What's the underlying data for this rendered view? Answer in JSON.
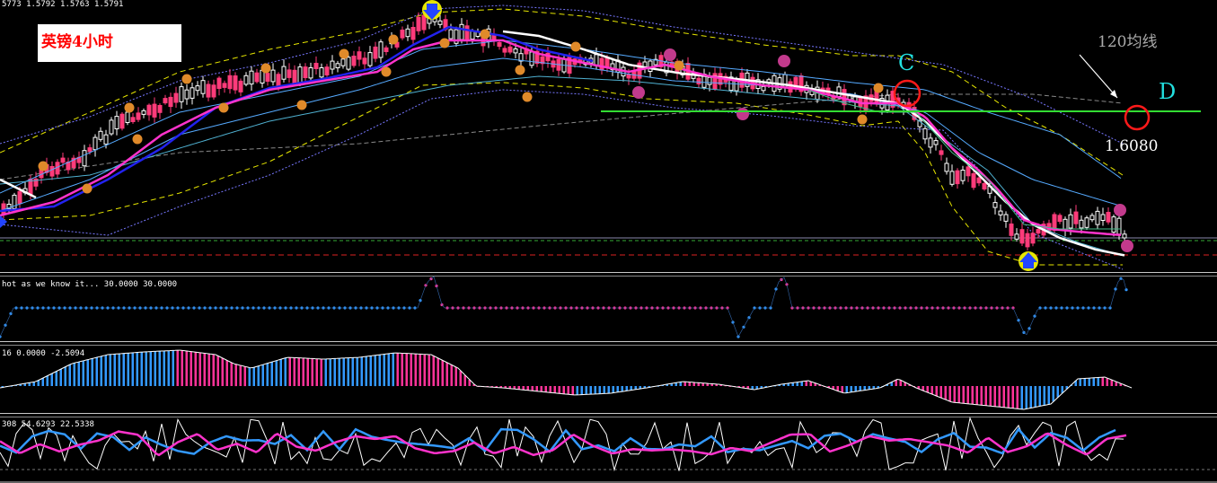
{
  "header": {
    "price_info": "5773 1.5792 1.5763 1.5791",
    "title": "英镑4小时"
  },
  "annotations": {
    "label_c": "C",
    "label_d": "D",
    "ma_label": "120均线",
    "target_price": "1.6080"
  },
  "panels": {
    "p1_label": "hot as we know it...  30.0000 30.0000",
    "p2_label": "16 0.0000 -2.5094",
    "p3_label": "308 54.6293 22.5338"
  },
  "colors": {
    "up_candle": "#ffffff",
    "down_candle": "#ff3b7a",
    "ma_white": "#ffffff",
    "ma_blue": "#2222ee",
    "ma_magenta": "#ff33cc",
    "band_yellow": "#e6e600",
    "band_lightblue": "#55aaff",
    "support_green": "#33dd33",
    "circle_red": "#ff1a1a",
    "label_cyan": "#22e0e0",
    "histogram_blue": "#3399ff",
    "histogram_pink": "#ff3399"
  },
  "chart_data": {
    "type": "line",
    "note_levels": {
      "support_line": "green horizontal",
      "target": "1.6080"
    }
  }
}
